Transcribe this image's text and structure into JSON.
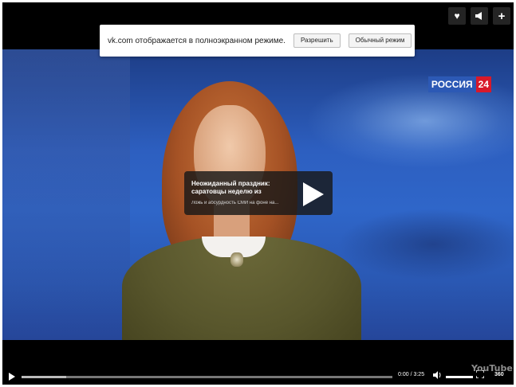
{
  "notice": {
    "message": "vk.com отображается в полноэкранном режиме.",
    "allow_label": "Разрешить",
    "normal_label": "Обычный режим"
  },
  "top_icons": [
    {
      "name": "heart-icon",
      "glyph": "♥"
    },
    {
      "name": "megaphone-icon",
      "glyph": "📢"
    },
    {
      "name": "plus-icon",
      "glyph": "+"
    }
  ],
  "channel": {
    "name": "РОССИЯ",
    "number": "24",
    "name_color": "#2c59b5",
    "number_color": "#d8192a"
  },
  "card": {
    "title": "Неожиданный праздник: саратовцы неделю из",
    "description": "Ложь и абсурдность СМИ на фоне на..."
  },
  "controls": {
    "time": "0:00 / 3:25",
    "quality": "360",
    "progress_loaded": 0.12,
    "volume_level": 1.0,
    "watermark": "YouTube"
  }
}
